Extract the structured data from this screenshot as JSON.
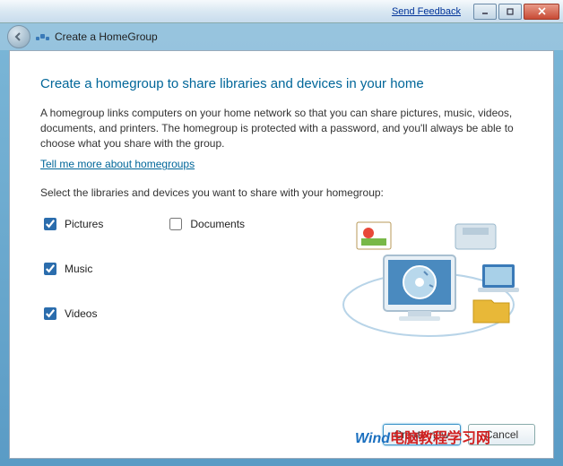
{
  "titlebar": {
    "feedback": "Send Feedback"
  },
  "nav": {
    "title": "Create a HomeGroup"
  },
  "content": {
    "heading": "Create a homegroup to share libraries and devices in your home",
    "description": "A homegroup links computers on your home network so that you can share pictures, music, videos, documents, and printers. The homegroup is protected with a password, and you'll always be able to choose what you share with the group.",
    "more_link": "Tell me more about homegroups",
    "select_label": "Select the libraries and devices you want to share with your homegroup:"
  },
  "checkboxes": {
    "pictures": {
      "label": "Pictures",
      "checked": true
    },
    "music": {
      "label": "Music",
      "checked": true
    },
    "videos": {
      "label": "Videos",
      "checked": true
    },
    "documents": {
      "label": "Documents",
      "checked": false
    }
  },
  "footer": {
    "primary": "Create now",
    "cancel": "Cancel"
  },
  "watermark": {
    "a": "Wind",
    "b": "电脑教程学习网"
  }
}
